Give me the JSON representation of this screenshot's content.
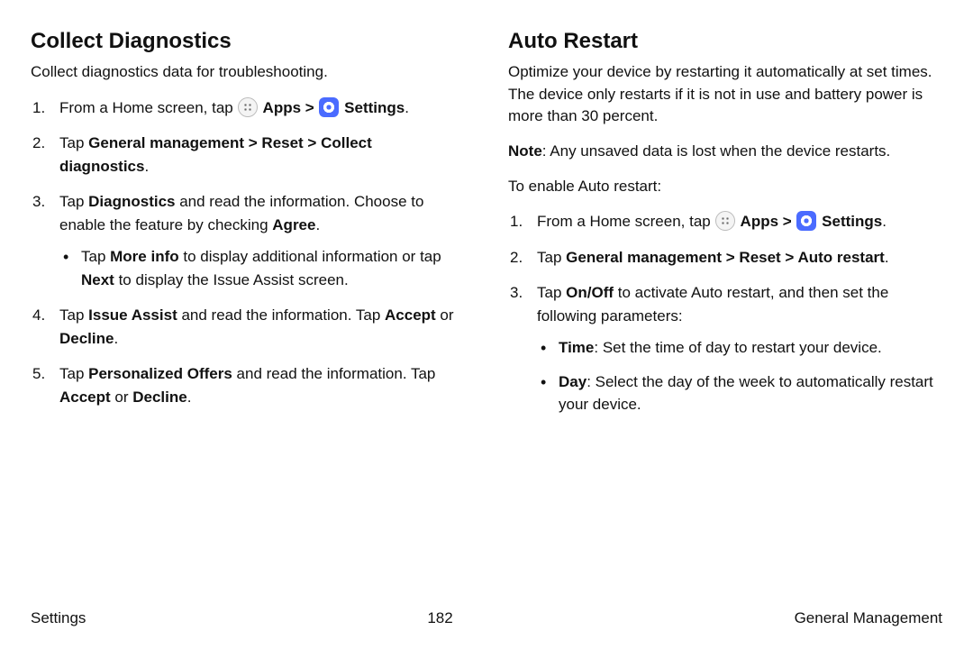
{
  "left": {
    "heading": "Collect Diagnostics",
    "intro": "Collect diagnostics data for troubleshooting.",
    "step1_a": "From a Home screen, tap ",
    "step1_apps": " Apps",
    "step1_sep": " > ",
    "step1_settings": " Settings",
    "step1_end": ".",
    "step2_a": "Tap ",
    "step2_b": "General management > Reset > Collect diagnostics",
    "step2_c": ".",
    "step3_a": "Tap ",
    "step3_b": "Diagnostics",
    "step3_c": " and read the information. Choose to enable the feature by checking ",
    "step3_d": "Agree",
    "step3_e": ".",
    "step3_bullet_a": "Tap ",
    "step3_bullet_b": "More info",
    "step3_bullet_c": " to display additional information or tap ",
    "step3_bullet_d": "Next",
    "step3_bullet_e": " to display the Issue Assist screen.",
    "step4_a": "Tap ",
    "step4_b": "Issue Assist",
    "step4_c": " and read the information. Tap ",
    "step4_d": "Accept",
    "step4_e": " or ",
    "step4_f": "Decline",
    "step4_g": ".",
    "step5_a": "Tap ",
    "step5_b": "Personalized Offers",
    "step5_c": " and read the information. Tap ",
    "step5_d": "Accept",
    "step5_e": " or ",
    "step5_f": "Decline",
    "step5_g": "."
  },
  "right": {
    "heading": "Auto Restart",
    "intro": "Optimize your device by restarting it automatically at set times. The device only restarts if it is not in use and battery power is more than 30 percent.",
    "note_label": "Note",
    "note_text": ": Any unsaved data is lost when the device restarts.",
    "enable_text": "To enable Auto restart:",
    "step1_a": "From a Home screen, tap ",
    "step1_apps": " Apps",
    "step1_sep": " > ",
    "step1_settings": " Settings",
    "step1_end": ".",
    "step2_a": "Tap ",
    "step2_b": "General management > Reset > Auto restart",
    "step2_c": ".",
    "step3_a": "Tap ",
    "step3_b": "On/Off",
    "step3_c": " to activate Auto restart, and then set the following parameters:",
    "bullet_time_a": "Time",
    "bullet_time_b": ": Set the time of day to restart your device.",
    "bullet_day_a": "Day",
    "bullet_day_b": ": Select the day of the week to automatically restart your device."
  },
  "footer": {
    "left": "Settings",
    "center": "182",
    "right": "General Management"
  }
}
